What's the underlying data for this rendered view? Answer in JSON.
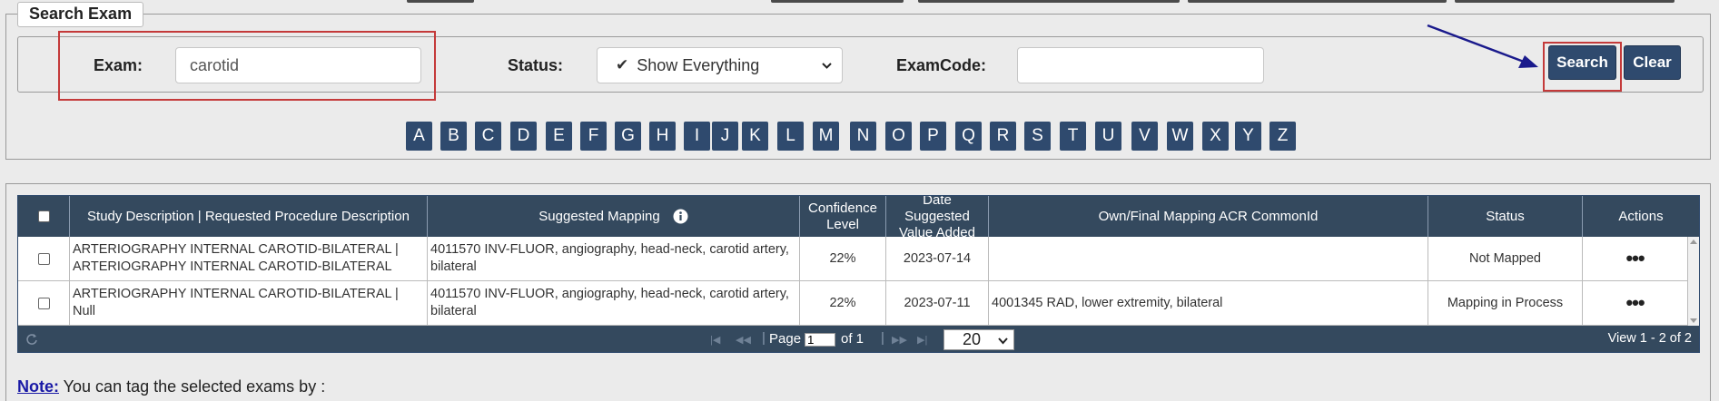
{
  "search": {
    "legend": "Search Exam",
    "exam_label": "Exam:",
    "exam_value": "carotid",
    "status_label": "Status:",
    "status_value": "Show Everything",
    "examcode_label": "ExamCode:",
    "examcode_value": "",
    "search_button": "Search",
    "clear_button": "Clear",
    "letters": [
      "A",
      "B",
      "C",
      "D",
      "E",
      "F",
      "G",
      "H",
      "I",
      "J",
      "K",
      "L",
      "M",
      "N",
      "O",
      "P",
      "Q",
      "R",
      "S",
      "T",
      "U",
      "V",
      "W",
      "X",
      "Y",
      "Z"
    ]
  },
  "grid": {
    "columns": [
      "",
      "Study Description | Requested Procedure Description",
      "Suggested Mapping",
      "Confidence Level",
      "Date Suggested Value Added",
      "Own/Final Mapping ACR CommonId",
      "Status",
      "Actions"
    ],
    "rows": [
      {
        "study": "ARTERIOGRAPHY INTERNAL CAROTID-BILATERAL | ARTERIOGRAPHY INTERNAL CAROTID-BILATERAL",
        "suggested": "4011570 INV-FLUOR, angiography, head-neck, carotid artery, bilateral",
        "confidence": "22%",
        "date": "2023-07-14",
        "own_mapping": "",
        "status": "Not Mapped",
        "actions": "•••"
      },
      {
        "study": "ARTERIOGRAPHY INTERNAL CAROTID-BILATERAL | Null",
        "suggested": "4011570 INV-FLUOR, angiography, head-neck, carotid artery, bilateral",
        "confidence": "22%",
        "date": "2023-07-11",
        "own_mapping": "4001345 RAD, lower extremity, bilateral",
        "status": "Mapping in Process",
        "actions": "•••"
      }
    ],
    "pager": {
      "page_label": "Page",
      "page_value": "1",
      "of_label": "of 1",
      "page_size": "20",
      "view_text": "View 1 - 2 of 2"
    }
  },
  "note": {
    "label": "Note:",
    "text": " You can tag the selected exams by :"
  },
  "colors": {
    "header_bg": "#34495e",
    "button_bg": "#2f4a6e",
    "highlight_red": "#c43a3a",
    "arrow": "#1a1a8c"
  }
}
